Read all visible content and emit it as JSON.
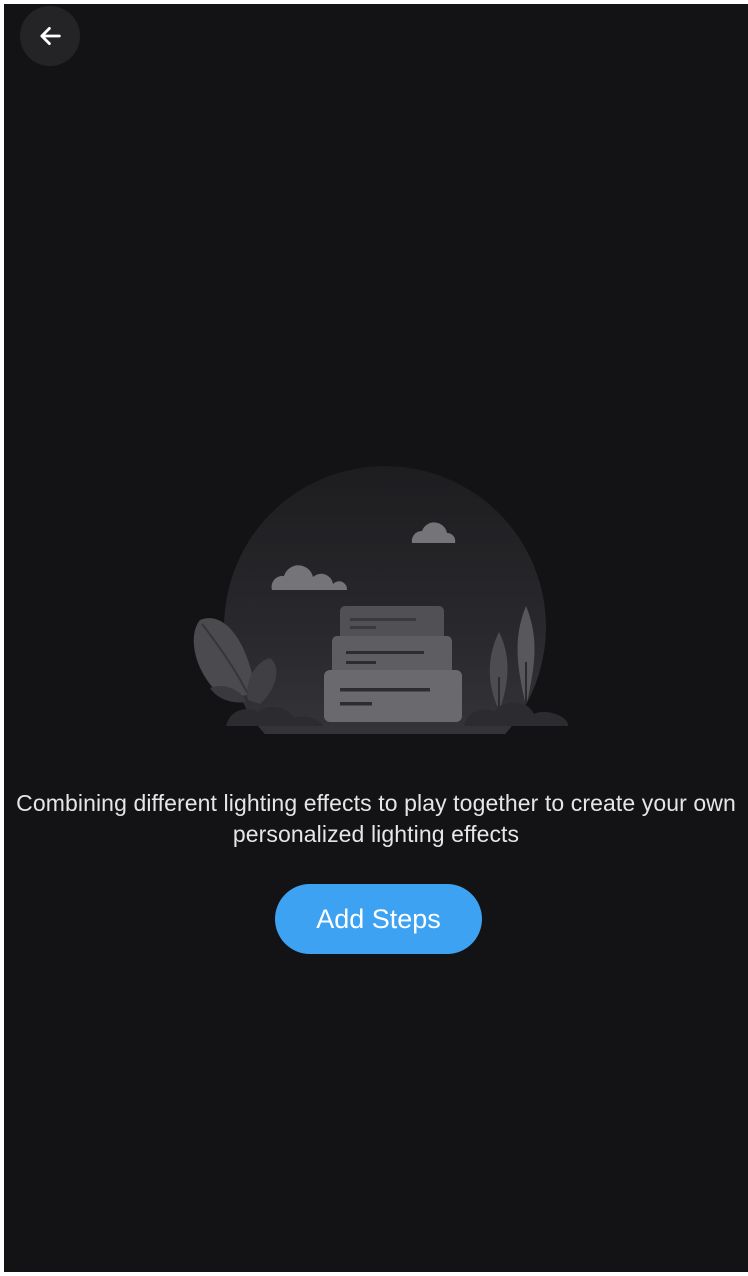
{
  "header": {
    "back_icon": "arrow-left-icon",
    "back_label": "Back"
  },
  "empty_state": {
    "illustration": "night-scene-stacked-cards-illustration",
    "message": "Combining different lighting effects to play together to create your own personalized lighting effects",
    "button_label": "Add Steps"
  },
  "colors": {
    "background": "#131315",
    "accent": "#3ea2f2",
    "text": "#e6e6e8"
  }
}
